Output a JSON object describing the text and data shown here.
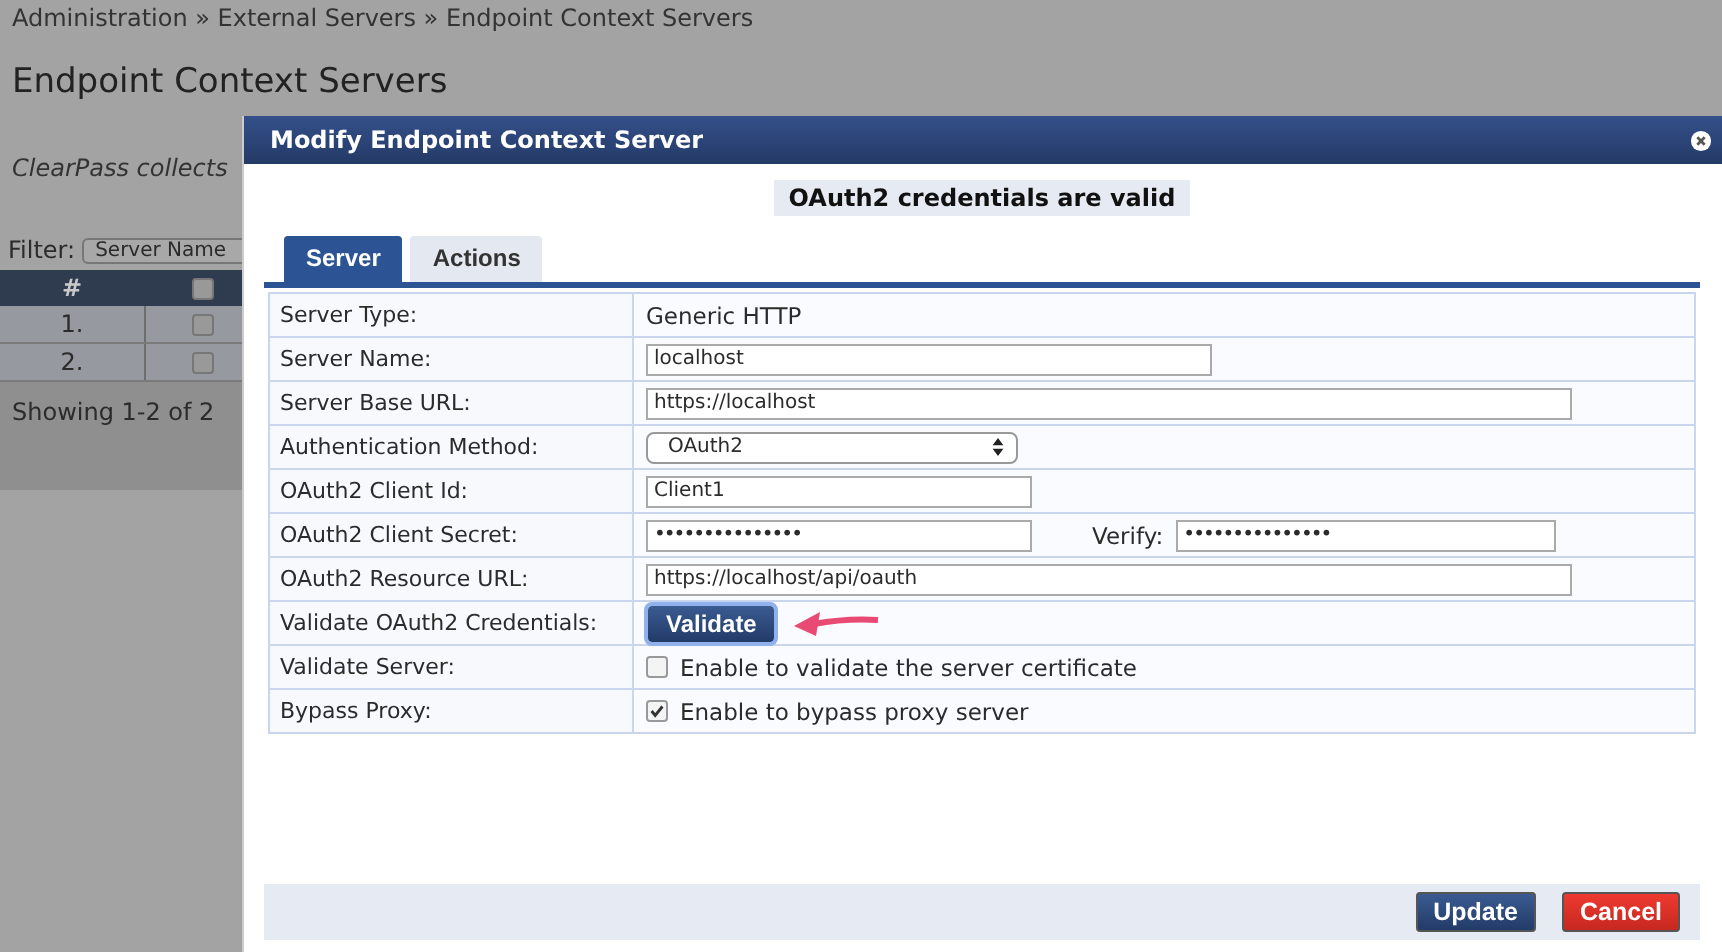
{
  "breadcrumb": "Administration » External Servers » Endpoint Context Servers",
  "page_title": "Endpoint Context Servers",
  "description": "ClearPass collects",
  "filter": {
    "label": "Filter:",
    "value": "Server Name"
  },
  "table": {
    "columns": [
      "#"
    ],
    "header_checked": false,
    "rows": [
      {
        "number": "1.",
        "checked": false
      },
      {
        "number": "2.",
        "checked": false
      }
    ],
    "footer": "Showing 1-2 of 2"
  },
  "dialog": {
    "title": "Modify Endpoint Context Server",
    "message": "OAuth2 credentials are valid",
    "tabs": [
      {
        "label": "Server",
        "selected": true
      },
      {
        "label": "Actions",
        "selected": false
      }
    ],
    "fields": [
      {
        "kind": "text",
        "label": "Server Type:",
        "value": "Generic HTTP"
      },
      {
        "kind": "input",
        "label": "Server Name:",
        "value": "localhost"
      },
      {
        "kind": "input",
        "label": "Server Base URL:",
        "value": "https://localhost"
      },
      {
        "kind": "select",
        "label": "Authentication Method:",
        "value": "OAuth2"
      },
      {
        "kind": "input",
        "label": "OAuth2 Client Id:",
        "value": "Client1"
      },
      {
        "kind": "password",
        "label": "OAuth2 Client Secret:",
        "value": "•••••••••••••••",
        "verify_label": "Verify:",
        "verify_value": "•••••••••••••••"
      },
      {
        "kind": "input",
        "label": "OAuth2 Resource URL:",
        "value": "https://localhost/api/oauth"
      },
      {
        "kind": "button",
        "label": "Validate OAuth2 Credentials:",
        "value": "Validate"
      },
      {
        "kind": "checkbox",
        "label": "Validate Server:",
        "value": "Enable to validate the server certificate",
        "checked": false
      },
      {
        "kind": "checkbox",
        "label": "Bypass Proxy:",
        "value": "Enable to bypass proxy server",
        "checked": true
      }
    ],
    "buttons": [
      {
        "label": "Update",
        "kind": "primary"
      },
      {
        "label": "Cancel",
        "kind": "danger"
      }
    ]
  }
}
